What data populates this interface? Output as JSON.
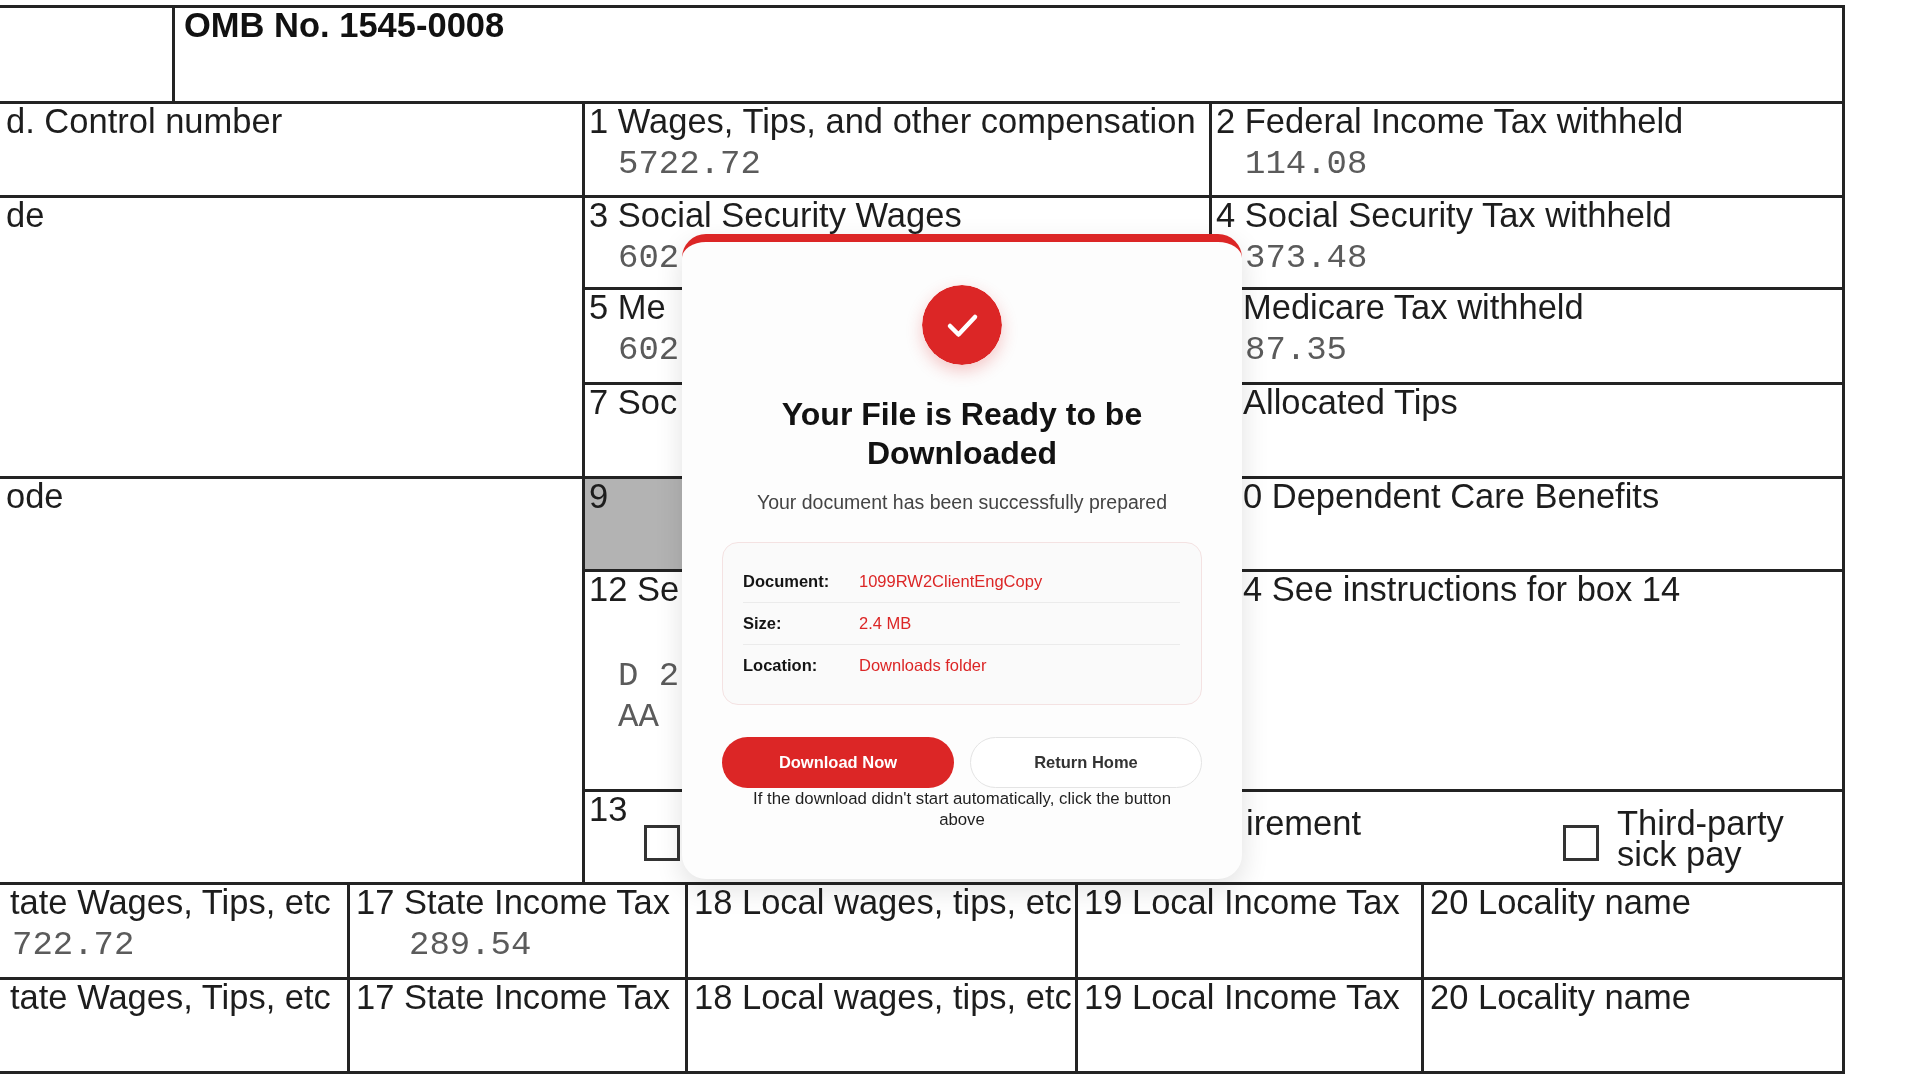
{
  "form": {
    "header": {
      "omb": "OMB No. 1545-0008"
    },
    "left_boxes": [
      {
        "label": "d. Control number"
      },
      {
        "label": "de"
      },
      {
        "label": "ode"
      }
    ],
    "middle_boxes": [
      {
        "label": "1 Wages, Tips, and other compensation",
        "values": [
          "5722.72"
        ],
        "shaded": false
      },
      {
        "label": "3 Social Security Wages",
        "values": [
          "602"
        ],
        "shaded": false
      },
      {
        "label": "5 Me",
        "values": [
          "602"
        ],
        "shaded": false
      },
      {
        "label": "7 Soc",
        "shaded": false
      },
      {
        "label": "9",
        "shaded": true
      },
      {
        "label": "12 Se",
        "values": [
          "D 2",
          "AA"
        ],
        "shaded": false
      }
    ],
    "right_boxes": [
      {
        "label": "2 Federal Income Tax withheld",
        "values": [
          "114.08"
        ]
      },
      {
        "label": "4 Social Security Tax withheld",
        "values": [
          "373.48"
        ]
      },
      {
        "label": "Medicare Tax withheld",
        "values": [
          "87.35"
        ]
      },
      {
        "label": "Allocated Tips"
      },
      {
        "label": "0 Dependent Care Benefits"
      },
      {
        "label": "4 See instructions for box 14"
      }
    ],
    "box_13": {
      "label": "13",
      "options": [
        {
          "checked": false
        },
        {
          "label": "irement"
        },
        {
          "checked": false,
          "label": "Third-party sick pay"
        }
      ]
    },
    "state_rows": [
      {
        "cells": [
          {
            "label": "tate Wages, Tips, etc",
            "values": [
              "722.72"
            ]
          },
          {
            "label": "17 State Income Tax",
            "values": [
              "289.54"
            ]
          },
          {
            "label": "18 Local wages, tips, etc"
          },
          {
            "label": "19 Local Income Tax"
          },
          {
            "label": "20 Locality name"
          }
        ]
      },
      {
        "cells": [
          {
            "label": "tate Wages, Tips, etc"
          },
          {
            "label": "17 State Income Tax"
          },
          {
            "label": "18 Local wages, tips, etc"
          },
          {
            "label": "19 Local Income Tax"
          },
          {
            "label": "20 Locality name"
          }
        ]
      }
    ]
  },
  "dialog": {
    "title": "Your File is Ready to be Downloaded",
    "subtitle": "Your document has been successfully prepared",
    "details": [
      {
        "label": "Document:",
        "value": "1099RW2ClientEngCopy"
      },
      {
        "label": "Size:",
        "value": "2.4 MB"
      },
      {
        "label": "Location:",
        "value": "Downloads folder"
      }
    ],
    "buttons": [
      {
        "label": "Download Now",
        "kind": "primary"
      },
      {
        "label": "Return Home",
        "kind": "secondary"
      }
    ],
    "help_text": "If the download didn't start automatically, click the button above"
  }
}
